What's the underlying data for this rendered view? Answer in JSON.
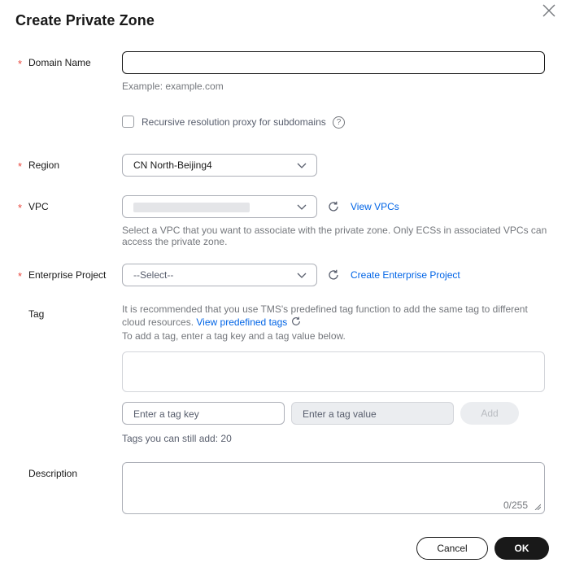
{
  "dialog": {
    "title": "Create Private Zone"
  },
  "fields": {
    "domain_name": {
      "label": "Domain Name",
      "value": "",
      "hint": "Example: example.com"
    },
    "recursive": {
      "label": "Recursive resolution proxy for subdomains",
      "checked": false,
      "help_glyph": "?"
    },
    "region": {
      "label": "Region",
      "value": "CN North-Beijing4"
    },
    "vpc": {
      "label": "VPC",
      "value": "",
      "link": "View VPCs",
      "hint_line1": "Select a VPC that you want to associate with the private zone. Only ECSs in associated VPCs can",
      "hint_line2": "access the private zone."
    },
    "enterprise_project": {
      "label": "Enterprise Project",
      "value": "--Select--",
      "link": "Create Enterprise Project"
    },
    "tag": {
      "label": "Tag",
      "hint_line1": "It is recommended that you use TMS's predefined tag function to add the same tag to different",
      "hint_line2_prefix": "cloud resources.",
      "hint_link": "View predefined tags",
      "hint_line3": "To add a tag, enter a tag key and a tag value below.",
      "key_placeholder": "Enter a tag key",
      "value_placeholder": "Enter a tag value",
      "add_label": "Add",
      "remaining": "Tags you can still add: 20"
    },
    "description": {
      "label": "Description",
      "value": "",
      "counter": "0/255"
    }
  },
  "required_marker": "*",
  "buttons": {
    "cancel": "Cancel",
    "ok": "OK"
  },
  "icons": {
    "close": "close-icon",
    "chevron": "chevron-down-icon",
    "refresh": "refresh-icon",
    "help": "help-icon"
  }
}
